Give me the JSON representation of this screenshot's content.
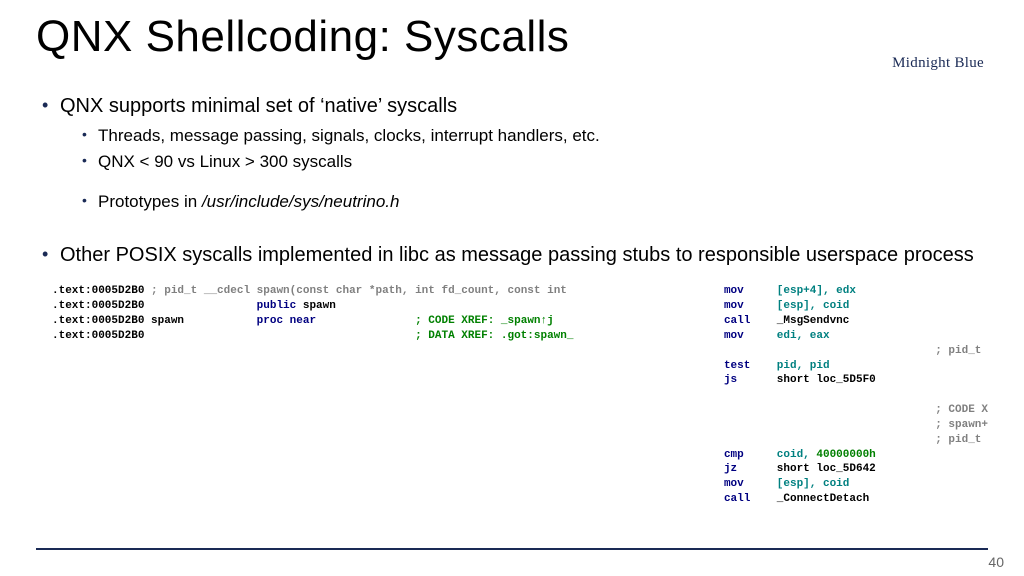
{
  "title": "QNX Shellcoding: Syscalls",
  "brand": {
    "name": "Midnight Blue"
  },
  "page_number": "40",
  "bullets": {
    "b1": "QNX supports minimal set of ‘native’ syscalls",
    "b1_1": "Threads, message passing, signals, clocks, interrupt handlers, etc.",
    "b1_2": "QNX < 90 vs Linux > 300 syscalls",
    "b1_3_pre": "Prototypes in ",
    "b1_3_ital": "/usr/include/sys/neutrino.h",
    "b2": "Other POSIX syscalls implemented in libc as message passing stubs to responsible userspace process"
  },
  "code_left": {
    "l1_addr": ".text:0005D2B0 ",
    "l1_cmt": "; pid_t __cdecl spawn(const char *path, int fd_count, const int",
    "l2_addr": ".text:0005D2B0                 ",
    "l2_kw": "public",
    "l2_id": " spawn",
    "l3_addr": ".text:0005D2B0 ",
    "l3_lbl": "spawn           ",
    "l3_kw": "proc near",
    "l3_cmt": "               ; CODE XREF: _spawn↑j",
    "l4_addr": ".text:0005D2B0                                         ",
    "l4_cmt": "; DATA XREF: .got:spawn_"
  },
  "code_right": {
    "r1_a": "mov     ",
    "r1_b": "[esp+4], edx",
    "r2_a": "mov     ",
    "r2_b": "[esp], coid",
    "r3_a": "call    ",
    "r3_b": "_MsgSendvnc",
    "r4_a": "mov     ",
    "r4_b": "edi, eax",
    "r4_cmt": "                                ; pid_t",
    "r5_a": "test    ",
    "r5_b": "pid, pid",
    "r6_a": "js      ",
    "r6_b": "short loc_5D5F0",
    "blank": "",
    "r7_cmt1": "                                ; CODE X",
    "r7_cmt2": "                                ; spawn+",
    "r7_cmt3": "                                ; pid_t",
    "r8_a": "cmp     ",
    "r8_b": "coid, ",
    "r8_c": "40000000h",
    "r9_a": "jz      ",
    "r9_b": "short loc_5D642",
    "r10_a": "mov     ",
    "r10_b": "[esp], coid",
    "r11_a": "call    ",
    "r11_b": "_ConnectDetach"
  }
}
